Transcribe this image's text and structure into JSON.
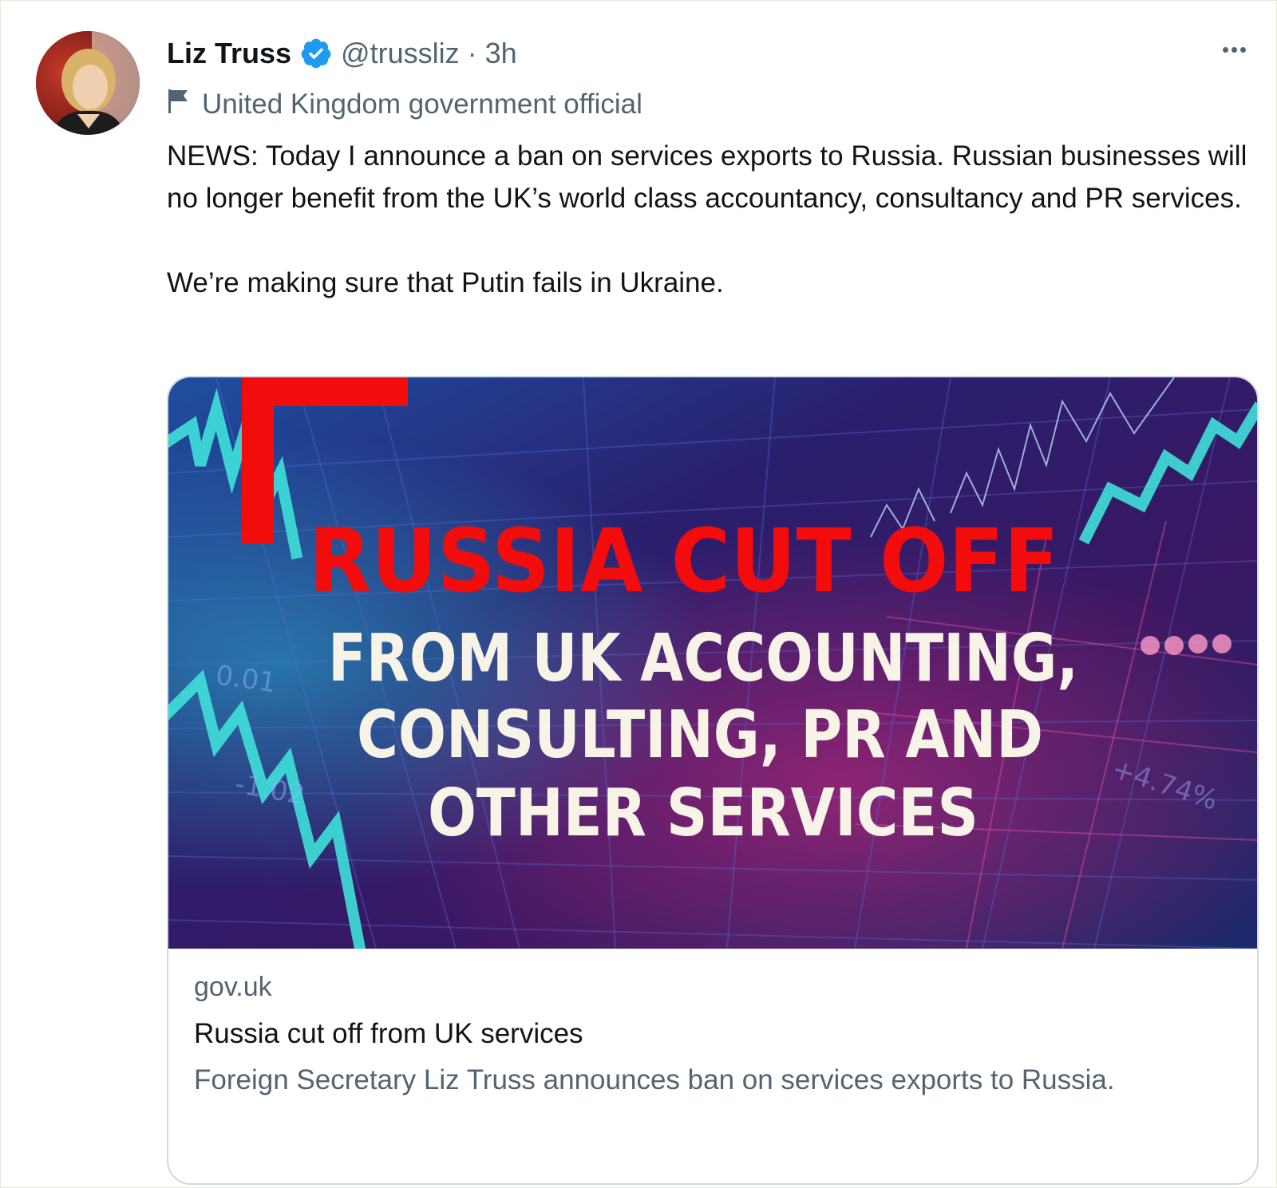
{
  "author": {
    "name": "Liz Truss",
    "handle": "@trussliz",
    "time": "· 3h",
    "label": "United Kingdom government official"
  },
  "tweet": {
    "paragraph1": "NEWS: Today I announce a ban on services exports to Russia. Russian businesses will no longer benefit from the UK’s world class accountancy, consultancy and PR services.",
    "paragraph2": "We’re making sure that Putin fails in Ukraine."
  },
  "card": {
    "image_headline_line1": "RUSSIA CUT OFF",
    "image_headline_line2": "FROM UK ACCOUNTING,",
    "image_headline_line3": "CONSULTING, PR AND",
    "image_headline_line4": "OTHER SERVICES",
    "image_ticker_1": "0.01",
    "image_ticker_2": "-1.02",
    "image_ticker_3": "+4.74%",
    "domain": "gov.uk",
    "title": "Russia cut off from UK services",
    "description": "Foreign Secretary Liz Truss announces ban on services exports to Russia."
  },
  "icons": {
    "verified": "verified-badge-icon",
    "flag": "flag-icon",
    "more": "more-options-icon"
  },
  "colors": {
    "verified_blue": "#1d9bf0",
    "headline_red": "#ff0000",
    "headline_white": "#f7f3e6",
    "muted_text": "#536471"
  }
}
